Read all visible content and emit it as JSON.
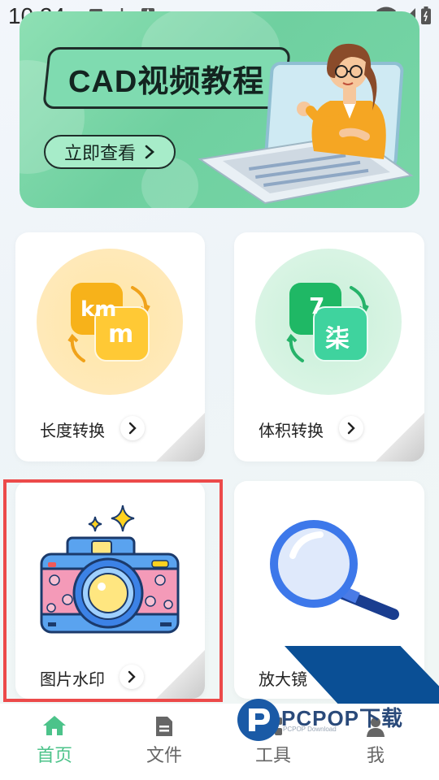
{
  "status_bar": {
    "time": "10:24"
  },
  "banner": {
    "title": "CAD视频教程",
    "button_label": "立即查看"
  },
  "cards": [
    {
      "label": "长度转换",
      "icon_text_1": "km",
      "icon_text_2": "m"
    },
    {
      "label": "体积转换",
      "icon_text_1": "7",
      "icon_text_2": "柒"
    },
    {
      "label": "图片水印"
    },
    {
      "label": "放大镜"
    }
  ],
  "tabs": [
    {
      "label": "首页",
      "active": true
    },
    {
      "label": "文件"
    },
    {
      "label": "工具"
    },
    {
      "label": "我"
    }
  ],
  "watermark": {
    "brand": "PCPOP下载",
    "sub": "PCPOP Download"
  },
  "colors": {
    "accent": "#4cc38a",
    "inactive": "#666666",
    "highlight": "#ec4a4a"
  }
}
